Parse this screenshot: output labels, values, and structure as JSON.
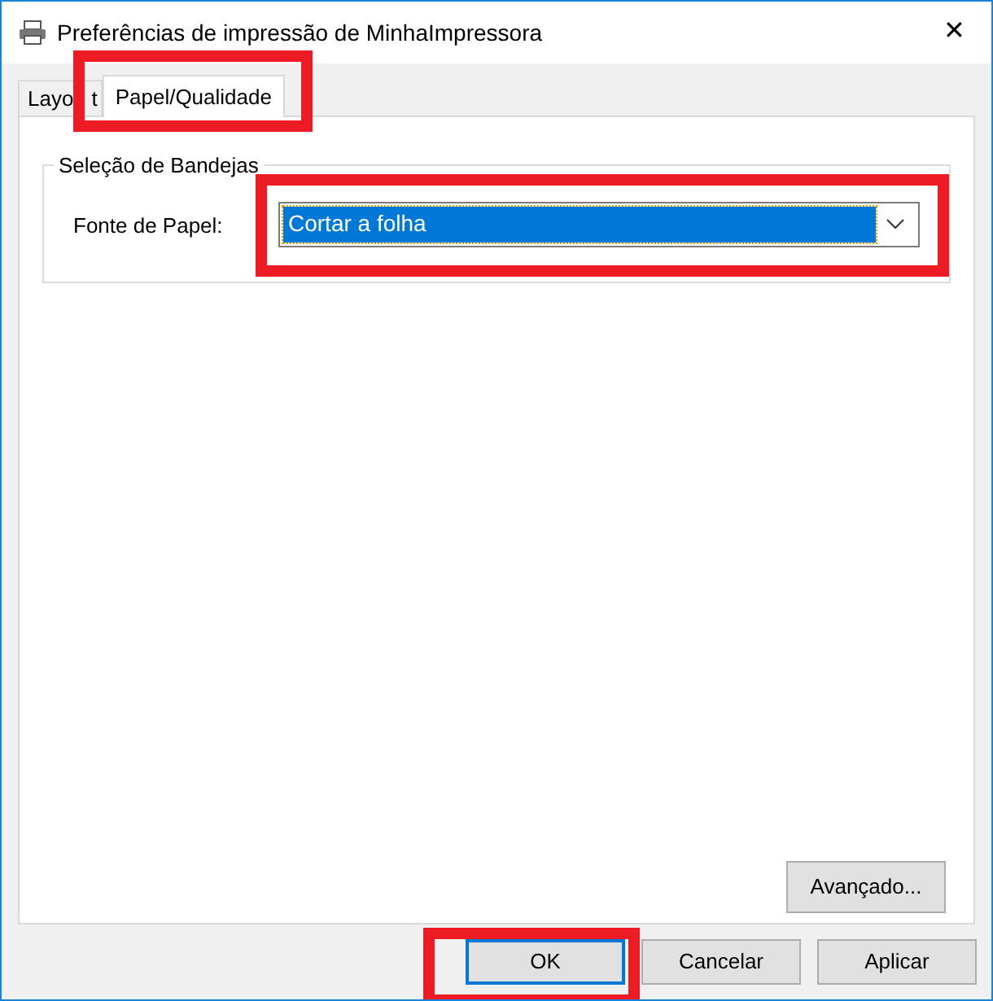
{
  "window": {
    "title": "Preferências de impressão de MinhaImpressora",
    "close": "✕"
  },
  "tabs": [
    {
      "label": "Layo t",
      "selected": false
    },
    {
      "label": "Papel/Qualidade",
      "selected": true
    }
  ],
  "group": {
    "title": "Seleção de Bandejas",
    "field_label": "Fonte de Papel:",
    "dropdown": {
      "value": "Cortar a folha",
      "focused": true
    }
  },
  "advanced_button": "Avançado...",
  "buttons": [
    {
      "label": "OK",
      "default": true
    },
    {
      "label": "Cancelar",
      "default": false
    },
    {
      "label": "Aplicar",
      "default": false
    }
  ]
}
